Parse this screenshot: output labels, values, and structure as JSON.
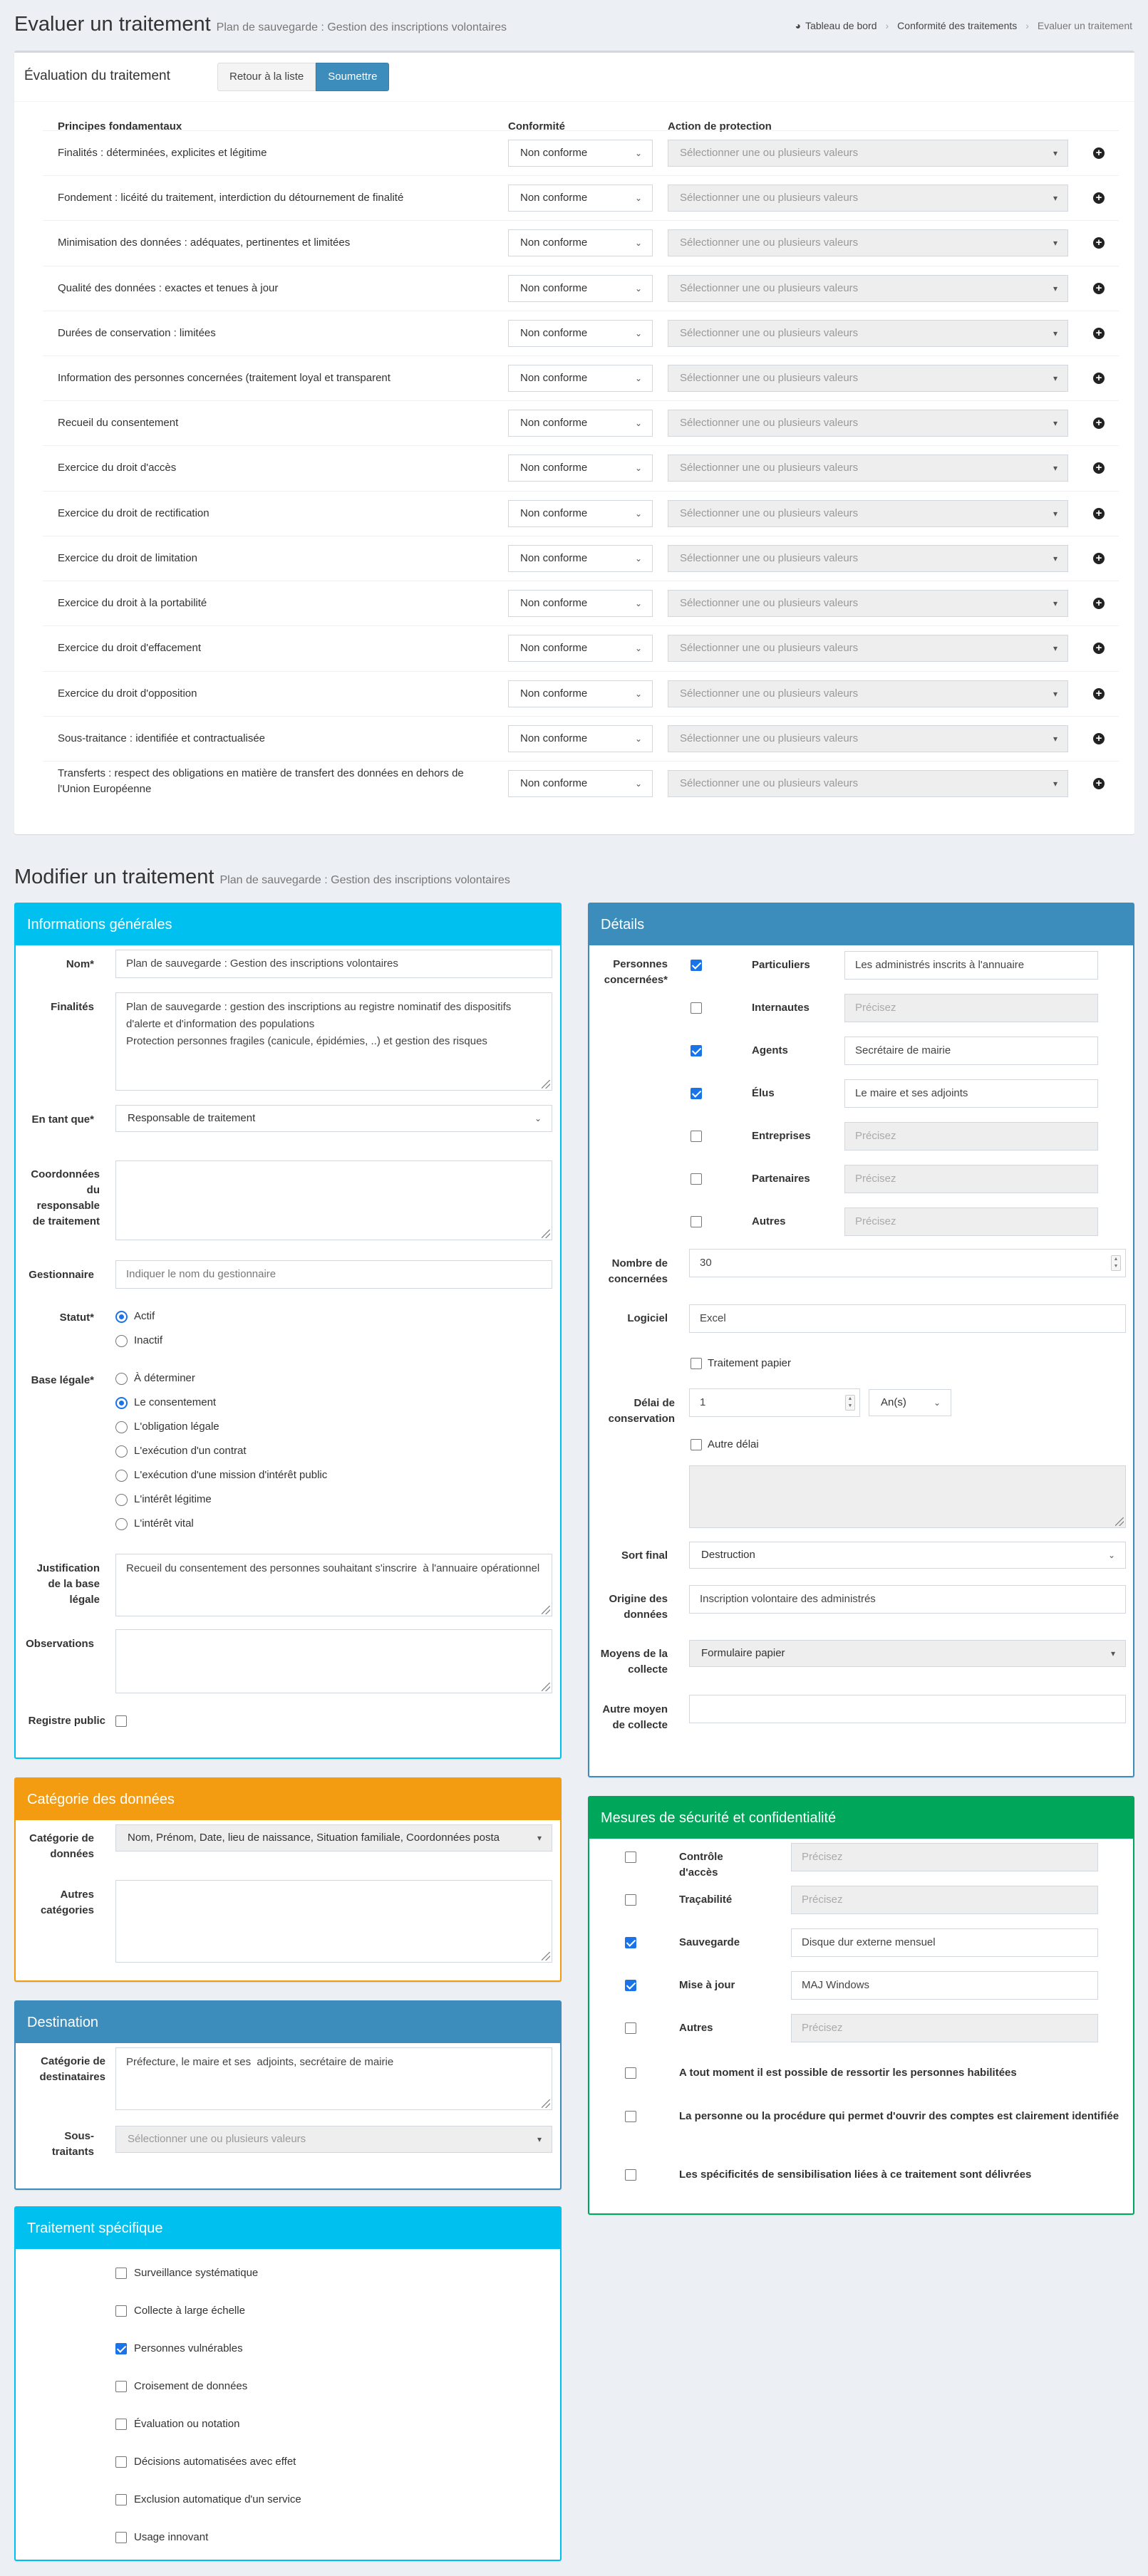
{
  "header": {
    "title": "Evaluer un traitement",
    "subtitle": "Plan de sauvegarde : Gestion des inscriptions volontaires",
    "breadcrumb": [
      "Tableau de bord",
      "Conformité des traitements",
      "Evaluer un traitement"
    ]
  },
  "evaluation": {
    "title": "Évaluation du traitement",
    "back_button": "Retour à la liste",
    "submit_button": "Soumettre",
    "col_principles": "Principes fondamentaux",
    "col_conformity": "Conformité",
    "col_action": "Action de protection",
    "rows": [
      {
        "principle": "Finalités : déterminées, explicites et légitime",
        "conformity": "Non conforme",
        "action": "Sélectionner une ou plusieurs valeurs"
      },
      {
        "principle": "Fondement : licéité du traitement, interdiction du détournement de finalité",
        "conformity": "Non conforme",
        "action": "Sélectionner une ou plusieurs valeurs"
      },
      {
        "principle": "Minimisation des données : adéquates, pertinentes et limitées",
        "conformity": "Non conforme",
        "action": "Sélectionner une ou plusieurs valeurs"
      },
      {
        "principle": "Qualité des données : exactes et tenues à jour",
        "conformity": "Non conforme",
        "action": "Sélectionner une ou plusieurs valeurs"
      },
      {
        "principle": "Durées de conservation : limitées",
        "conformity": "Non conforme",
        "action": "Sélectionner une ou plusieurs valeurs"
      },
      {
        "principle": "Information des personnes concernées (traitement loyal et transparent",
        "conformity": "Non conforme",
        "action": "Sélectionner une ou plusieurs valeurs"
      },
      {
        "principle": "Recueil du consentement",
        "conformity": "Non conforme",
        "action": "Sélectionner une ou plusieurs valeurs"
      },
      {
        "principle": "Exercice du droit d'accès",
        "conformity": "Non conforme",
        "action": "Sélectionner une ou plusieurs valeurs"
      },
      {
        "principle": "Exercice du droit de rectification",
        "conformity": "Non conforme",
        "action": "Sélectionner une ou plusieurs valeurs"
      },
      {
        "principle": "Exercice du droit de limitation",
        "conformity": "Non conforme",
        "action": "Sélectionner une ou plusieurs valeurs"
      },
      {
        "principle": "Exercice du droit à la portabilité",
        "conformity": "Non conforme",
        "action": "Sélectionner une ou plusieurs valeurs"
      },
      {
        "principle": "Exercice du droit d'effacement",
        "conformity": "Non conforme",
        "action": "Sélectionner une ou plusieurs valeurs"
      },
      {
        "principle": "Exercice du droit d'opposition",
        "conformity": "Non conforme",
        "action": "Sélectionner une ou plusieurs valeurs"
      },
      {
        "principle": "Sous-traitance : identifiée et contractualisée",
        "conformity": "Non conforme",
        "action": "Sélectionner une ou plusieurs valeurs"
      },
      {
        "principle": "Transferts : respect des obligations en matière de transfert des données en dehors de l'Union Européenne",
        "conformity": "Non conforme",
        "action": "Sélectionner une ou plusieurs valeurs"
      }
    ]
  },
  "modify": {
    "title": "Modifier un traitement",
    "subtitle": "Plan de sauvegarde : Gestion des inscriptions volontaires"
  },
  "general": {
    "title": "Informations générales",
    "nom_label": "Nom*",
    "nom_value": "Plan de sauvegarde : Gestion des inscriptions volontaires",
    "finalites_label": "Finalités",
    "finalites_value": "Plan de sauvegarde : gestion des inscriptions au registre nominatif des dispositifs d'alerte et d'information des populations\nProtection personnes fragiles (canicule, épidémies, ..) et gestion des risques",
    "entantque_label": "En tant que*",
    "entantque_value": "Responsable de traitement",
    "coord_label": "Coordonnées du responsable de traitement",
    "coord_value": "",
    "gestionnaire_label": "Gestionnaire",
    "gestionnaire_placeholder": "Indiquer le nom du gestionnaire",
    "statut_label": "Statut*",
    "statut_options": [
      {
        "label": "Actif",
        "selected": true
      },
      {
        "label": "Inactif",
        "selected": false
      }
    ],
    "base_label": "Base légale*",
    "base_options": [
      {
        "label": "À déterminer",
        "selected": false
      },
      {
        "label": "Le consentement",
        "selected": true
      },
      {
        "label": "L'obligation légale",
        "selected": false
      },
      {
        "label": "L'exécution d'un contrat",
        "selected": false
      },
      {
        "label": "L'exécution d'une mission d'intérêt public",
        "selected": false
      },
      {
        "label": "L'intérêt légitime",
        "selected": false
      },
      {
        "label": "L'intérêt vital",
        "selected": false
      }
    ],
    "justif_label": "Justification de la base légale",
    "justif_value": "Recueil du consentement des personnes souhaitant s'inscrire  à l'annuaire opérationnel",
    "observations_label": "Observations",
    "observations_value": "",
    "registre_label": "Registre public",
    "registre_checked": false
  },
  "categorie": {
    "title": "Catégorie des données",
    "cat_label": "Catégorie de données",
    "cat_value": "Nom, Prénom, Date, lieu de naissance, Situation familiale, Coordonnées posta",
    "autres_label": "Autres catégories",
    "autres_value": ""
  },
  "destination": {
    "title": "Destination",
    "cat_label": "Catégorie de destinataires",
    "cat_value": "Préfecture, le maire et ses  adjoints, secrétaire de mairie",
    "sous_label": "Sous-traitants",
    "sous_placeholder": "Sélectionner une ou plusieurs valeurs"
  },
  "specifique": {
    "title": "Traitement spécifique",
    "items": [
      {
        "label": "Surveillance systématique",
        "checked": false
      },
      {
        "label": "Collecte à large échelle",
        "checked": false
      },
      {
        "label": "Personnes vulnérables",
        "checked": true
      },
      {
        "label": "Croisement de données",
        "checked": false
      },
      {
        "label": "Évaluation ou notation",
        "checked": false
      },
      {
        "label": "Décisions automatisées avec effet",
        "checked": false
      },
      {
        "label": "Exclusion automatique d'un service",
        "checked": false
      },
      {
        "label": "Usage innovant",
        "checked": false
      }
    ]
  },
  "details": {
    "title": "Détails",
    "personnes_label": "Personnes concernées*",
    "personnes": [
      {
        "label": "Particuliers",
        "checked": true,
        "value": "Les administrés inscrits à l'annuaire"
      },
      {
        "label": "Internautes",
        "checked": false,
        "value": "Précisez"
      },
      {
        "label": "Agents",
        "checked": true,
        "value": "Secrétaire de mairie"
      },
      {
        "label": "Élus",
        "checked": true,
        "value": "Le maire et ses adjoints"
      },
      {
        "label": "Entreprises",
        "checked": false,
        "value": "Précisez"
      },
      {
        "label": "Partenaires",
        "checked": false,
        "value": "Précisez"
      },
      {
        "label": "Autres",
        "checked": false,
        "value": "Précisez"
      }
    ],
    "nombre_label": "Nombre de concernées",
    "nombre_value": "30",
    "logiciel_label": "Logiciel",
    "logiciel_value": "Excel",
    "papier_label": "Traitement papier",
    "delai_label": "Délai de conservation",
    "delai_value": "1",
    "delai_unit": "An(s)",
    "autre_delai_label": "Autre délai",
    "sort_label": "Sort final",
    "sort_value": "Destruction",
    "origine_label": "Origine des données",
    "origine_value": "Inscription volontaire des administrés",
    "moyens_label": "Moyens de la collecte",
    "moyens_value": "Formulaire papier",
    "autre_moyen_label": "Autre moyen de collecte",
    "autre_moyen_value": ""
  },
  "mesures": {
    "title": "Mesures de sécurité et confidentialité",
    "items": [
      {
        "label": "Contrôle d'accès",
        "checked": false,
        "value": "Précisez",
        "filled": false
      },
      {
        "label": "Traçabilité",
        "checked": false,
        "value": "Précisez",
        "filled": false
      },
      {
        "label": "Sauvegarde",
        "checked": true,
        "value": "Disque dur externe mensuel",
        "filled": true
      },
      {
        "label": "Mise à jour",
        "checked": true,
        "value": "MAJ Windows",
        "filled": true
      },
      {
        "label": "Autres",
        "checked": false,
        "value": "Précisez",
        "filled": false
      }
    ],
    "statements": [
      "A tout moment il est possible de ressortir les personnes habilitées",
      "La personne ou la procédure qui permet d'ouvrir des comptes est clairement identifiée",
      "Les spécificités de sensibilisation liées à ce traitement sont délivrées"
    ]
  },
  "colors": {
    "aqua": "#00c0ef",
    "blue": "#3c8dbc",
    "orange": "#f39c12",
    "green": "#00a65a",
    "check": "#1a73e8"
  }
}
